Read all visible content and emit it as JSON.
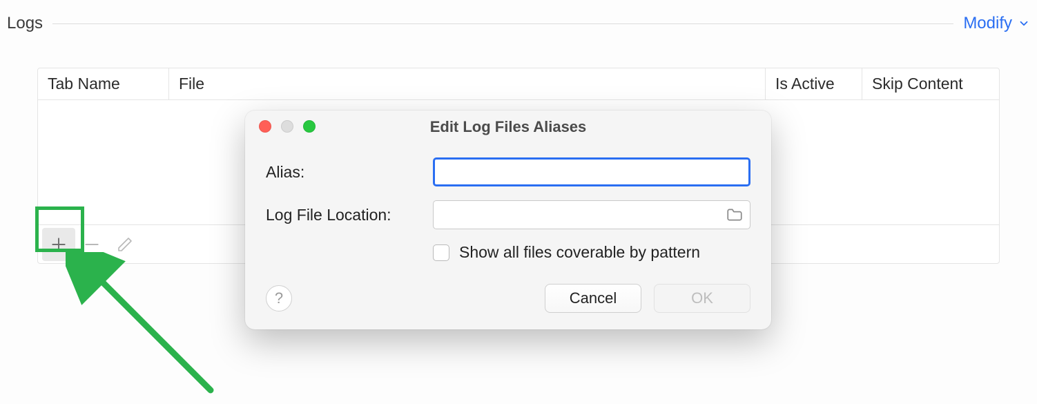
{
  "section": {
    "title": "Logs",
    "modify_label": "Modify"
  },
  "table": {
    "columns": {
      "tab_name": "Tab Name",
      "file": "File",
      "is_active": "Is Active",
      "skip_content": "Skip Content"
    },
    "rows": []
  },
  "dialog": {
    "title": "Edit Log Files Aliases",
    "alias_label": "Alias:",
    "alias_value": "",
    "location_label": "Log File Location:",
    "location_value": "",
    "show_all_label": "Show all files coverable by pattern",
    "show_all_checked": false,
    "cancel_label": "Cancel",
    "ok_label": "OK",
    "ok_enabled": false,
    "help_label": "?"
  },
  "icons": {
    "add": "plus-icon",
    "remove": "minus-icon",
    "edit": "pencil-icon",
    "chevron": "chevron-down-icon",
    "folder": "folder-icon"
  }
}
